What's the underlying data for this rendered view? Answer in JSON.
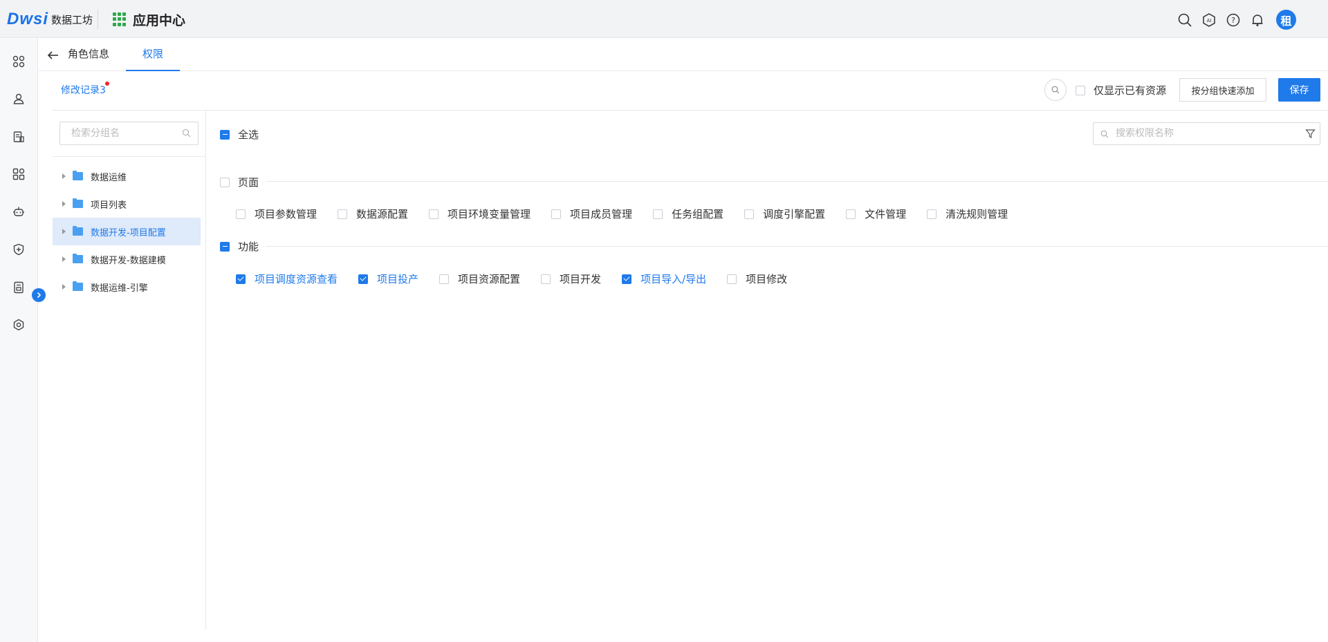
{
  "topbar": {
    "logo_mark": "Dwsi",
    "logo_text": "数据工坊",
    "app_center": "应用中心",
    "avatar_text": "租",
    "icons": [
      "search-icon",
      "ai-icon",
      "help-icon",
      "bell-icon"
    ]
  },
  "rail": {
    "icons": [
      "apps-icon",
      "user-icon",
      "document-icon",
      "modules-icon",
      "robot-icon",
      "shield-icon",
      "book-icon",
      "settings-icon"
    ]
  },
  "tabs": {
    "role_info": "角色信息",
    "permissions": "权限"
  },
  "actions": {
    "history": "修改记录3",
    "only_owned": "仅显示已有资源",
    "quick_add": "按分组快速添加",
    "save": "保存"
  },
  "tree": {
    "search_placeholder": "检索分组名",
    "items": [
      {
        "label": "数据运维",
        "selected": false
      },
      {
        "label": "项目列表",
        "selected": false
      },
      {
        "label": "数据开发-项目配置",
        "selected": true
      },
      {
        "label": "数据开发-数据建模",
        "selected": false
      },
      {
        "label": "数据运维-引擎",
        "selected": false
      }
    ]
  },
  "perms": {
    "select_all": "全选",
    "search_placeholder": "搜索权限名称",
    "page_section": {
      "title": "页面",
      "items": [
        {
          "label": "项目参数管理",
          "checked": false
        },
        {
          "label": "数据源配置",
          "checked": false
        },
        {
          "label": "项目环境变量管理",
          "checked": false
        },
        {
          "label": "项目成员管理",
          "checked": false
        },
        {
          "label": "任务组配置",
          "checked": false
        },
        {
          "label": "调度引擎配置",
          "checked": false
        },
        {
          "label": "文件管理",
          "checked": false
        },
        {
          "label": "清洗规则管理",
          "checked": false
        }
      ]
    },
    "func_section": {
      "title": "功能",
      "items": [
        {
          "label": "项目调度资源查看",
          "checked": true
        },
        {
          "label": "项目投产",
          "checked": true
        },
        {
          "label": "项目资源配置",
          "checked": false
        },
        {
          "label": "项目开发",
          "checked": false
        },
        {
          "label": "项目导入/导出",
          "checked": true
        },
        {
          "label": "项目修改",
          "checked": false
        }
      ]
    }
  },
  "colors": {
    "accent": "#1f7aea",
    "selected_bg": "#dfeafa",
    "badge": "#f5222d"
  }
}
